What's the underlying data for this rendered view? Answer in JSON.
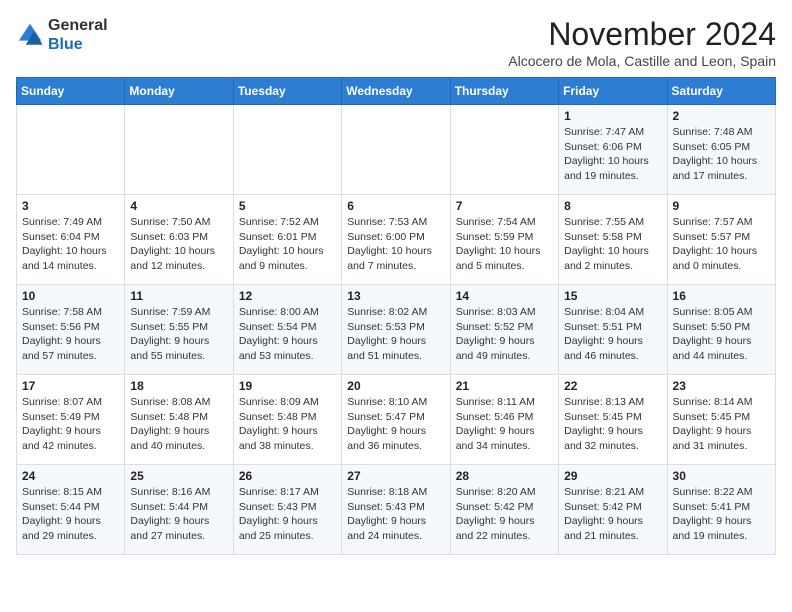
{
  "logo": {
    "general": "General",
    "blue": "Blue"
  },
  "header": {
    "month": "November 2024",
    "location": "Alcocero de Mola, Castille and Leon, Spain"
  },
  "weekdays": [
    "Sunday",
    "Monday",
    "Tuesday",
    "Wednesday",
    "Thursday",
    "Friday",
    "Saturday"
  ],
  "weeks": [
    [
      {
        "day": "",
        "info": ""
      },
      {
        "day": "",
        "info": ""
      },
      {
        "day": "",
        "info": ""
      },
      {
        "day": "",
        "info": ""
      },
      {
        "day": "",
        "info": ""
      },
      {
        "day": "1",
        "info": "Sunrise: 7:47 AM\nSunset: 6:06 PM\nDaylight: 10 hours and 19 minutes."
      },
      {
        "day": "2",
        "info": "Sunrise: 7:48 AM\nSunset: 6:05 PM\nDaylight: 10 hours and 17 minutes."
      }
    ],
    [
      {
        "day": "3",
        "info": "Sunrise: 7:49 AM\nSunset: 6:04 PM\nDaylight: 10 hours and 14 minutes."
      },
      {
        "day": "4",
        "info": "Sunrise: 7:50 AM\nSunset: 6:03 PM\nDaylight: 10 hours and 12 minutes."
      },
      {
        "day": "5",
        "info": "Sunrise: 7:52 AM\nSunset: 6:01 PM\nDaylight: 10 hours and 9 minutes."
      },
      {
        "day": "6",
        "info": "Sunrise: 7:53 AM\nSunset: 6:00 PM\nDaylight: 10 hours and 7 minutes."
      },
      {
        "day": "7",
        "info": "Sunrise: 7:54 AM\nSunset: 5:59 PM\nDaylight: 10 hours and 5 minutes."
      },
      {
        "day": "8",
        "info": "Sunrise: 7:55 AM\nSunset: 5:58 PM\nDaylight: 10 hours and 2 minutes."
      },
      {
        "day": "9",
        "info": "Sunrise: 7:57 AM\nSunset: 5:57 PM\nDaylight: 10 hours and 0 minutes."
      }
    ],
    [
      {
        "day": "10",
        "info": "Sunrise: 7:58 AM\nSunset: 5:56 PM\nDaylight: 9 hours and 57 minutes."
      },
      {
        "day": "11",
        "info": "Sunrise: 7:59 AM\nSunset: 5:55 PM\nDaylight: 9 hours and 55 minutes."
      },
      {
        "day": "12",
        "info": "Sunrise: 8:00 AM\nSunset: 5:54 PM\nDaylight: 9 hours and 53 minutes."
      },
      {
        "day": "13",
        "info": "Sunrise: 8:02 AM\nSunset: 5:53 PM\nDaylight: 9 hours and 51 minutes."
      },
      {
        "day": "14",
        "info": "Sunrise: 8:03 AM\nSunset: 5:52 PM\nDaylight: 9 hours and 49 minutes."
      },
      {
        "day": "15",
        "info": "Sunrise: 8:04 AM\nSunset: 5:51 PM\nDaylight: 9 hours and 46 minutes."
      },
      {
        "day": "16",
        "info": "Sunrise: 8:05 AM\nSunset: 5:50 PM\nDaylight: 9 hours and 44 minutes."
      }
    ],
    [
      {
        "day": "17",
        "info": "Sunrise: 8:07 AM\nSunset: 5:49 PM\nDaylight: 9 hours and 42 minutes."
      },
      {
        "day": "18",
        "info": "Sunrise: 8:08 AM\nSunset: 5:48 PM\nDaylight: 9 hours and 40 minutes."
      },
      {
        "day": "19",
        "info": "Sunrise: 8:09 AM\nSunset: 5:48 PM\nDaylight: 9 hours and 38 minutes."
      },
      {
        "day": "20",
        "info": "Sunrise: 8:10 AM\nSunset: 5:47 PM\nDaylight: 9 hours and 36 minutes."
      },
      {
        "day": "21",
        "info": "Sunrise: 8:11 AM\nSunset: 5:46 PM\nDaylight: 9 hours and 34 minutes."
      },
      {
        "day": "22",
        "info": "Sunrise: 8:13 AM\nSunset: 5:45 PM\nDaylight: 9 hours and 32 minutes."
      },
      {
        "day": "23",
        "info": "Sunrise: 8:14 AM\nSunset: 5:45 PM\nDaylight: 9 hours and 31 minutes."
      }
    ],
    [
      {
        "day": "24",
        "info": "Sunrise: 8:15 AM\nSunset: 5:44 PM\nDaylight: 9 hours and 29 minutes."
      },
      {
        "day": "25",
        "info": "Sunrise: 8:16 AM\nSunset: 5:44 PM\nDaylight: 9 hours and 27 minutes."
      },
      {
        "day": "26",
        "info": "Sunrise: 8:17 AM\nSunset: 5:43 PM\nDaylight: 9 hours and 25 minutes."
      },
      {
        "day": "27",
        "info": "Sunrise: 8:18 AM\nSunset: 5:43 PM\nDaylight: 9 hours and 24 minutes."
      },
      {
        "day": "28",
        "info": "Sunrise: 8:20 AM\nSunset: 5:42 PM\nDaylight: 9 hours and 22 minutes."
      },
      {
        "day": "29",
        "info": "Sunrise: 8:21 AM\nSunset: 5:42 PM\nDaylight: 9 hours and 21 minutes."
      },
      {
        "day": "30",
        "info": "Sunrise: 8:22 AM\nSunset: 5:41 PM\nDaylight: 9 hours and 19 minutes."
      }
    ]
  ]
}
